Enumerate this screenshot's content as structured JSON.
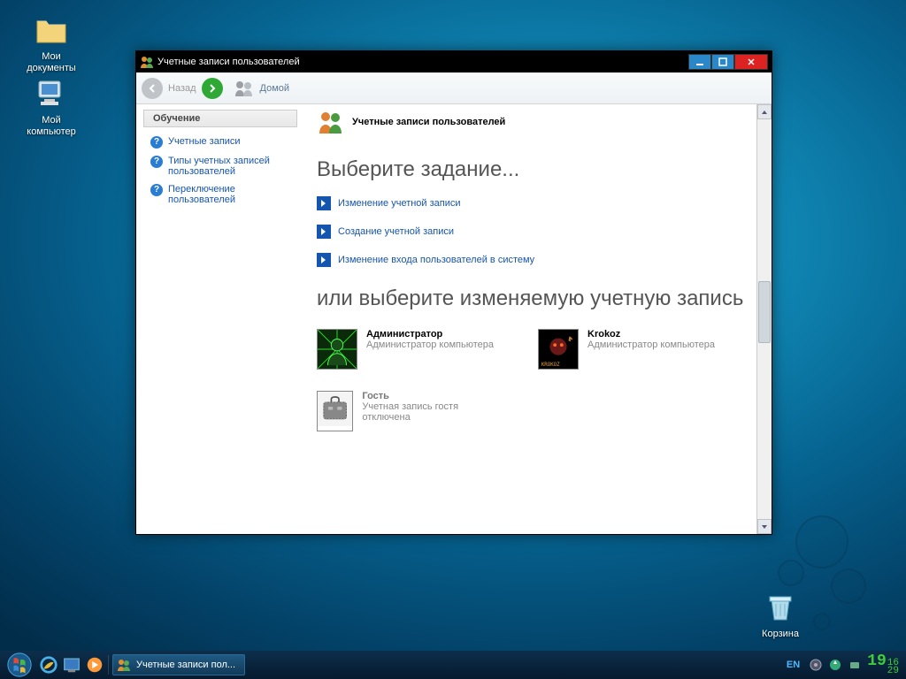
{
  "desktop": {
    "documents": "Мои документы",
    "computer": "Мой компьютер",
    "recycle": "Корзина"
  },
  "window": {
    "title": "Учетные записи пользователей",
    "toolbar": {
      "back": "Назад",
      "home": "Домой"
    },
    "sidebar": {
      "heading": "Обучение",
      "items": [
        "Учетные записи",
        "Типы учетных записей пользователей",
        "Переключение пользователей"
      ]
    },
    "main": {
      "header": "Учетные записи пользователей",
      "h1": "Выберите задание...",
      "tasks": [
        "Изменение учетной записи",
        "Создание учетной записи",
        "Изменение входа пользователей в систему"
      ],
      "h2": "или выберите изменяемую учетную запись",
      "accounts": [
        {
          "name": "Администратор",
          "type": "Администратор компьютера"
        },
        {
          "name": "Krokoz",
          "type": "Администратор компьютера"
        },
        {
          "name": "Гость",
          "type": "Учетная запись гостя отключена"
        }
      ]
    }
  },
  "taskbar": {
    "active": "Учетные записи пол...",
    "lang": "EN",
    "clock": {
      "hour": "19",
      "min": "16",
      "day": "29"
    }
  }
}
